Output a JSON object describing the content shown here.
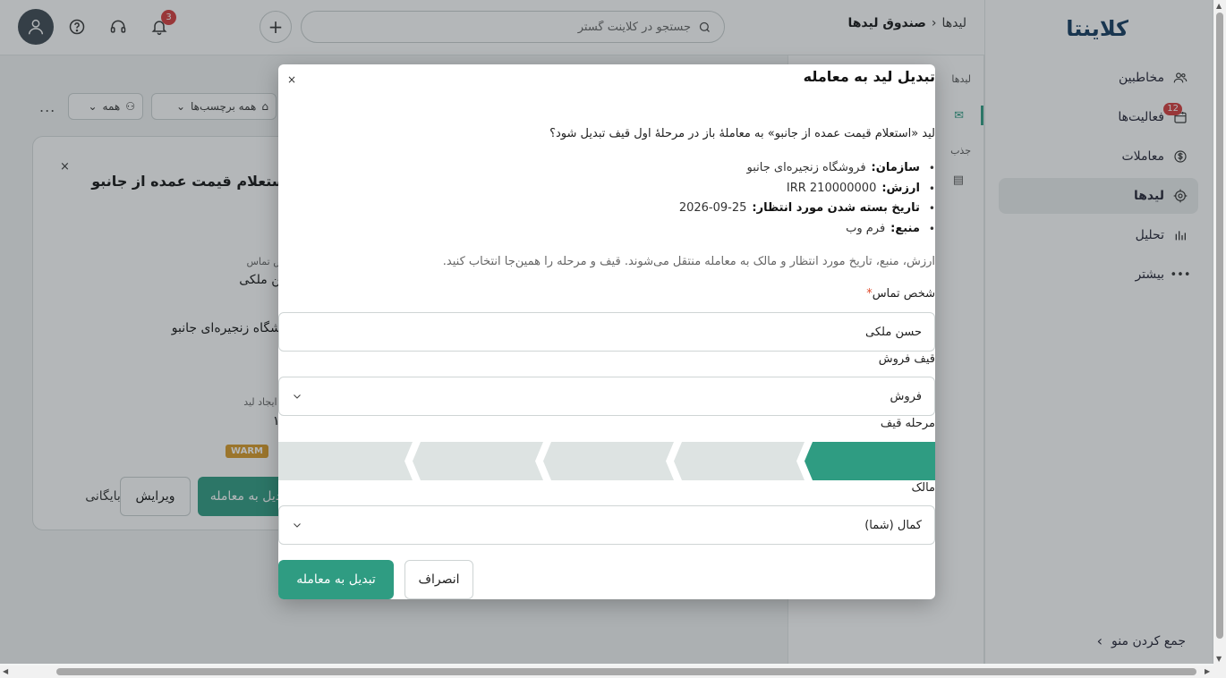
{
  "sidebar": {
    "logo": "کلاینتا",
    "items": [
      {
        "label": "مخاطبین",
        "icon": "users-icon"
      },
      {
        "label": "فعالیت‌ها",
        "icon": "calendar-icon",
        "badge": "12"
      },
      {
        "label": "معاملات",
        "icon": "dollar-icon"
      },
      {
        "label": "لیدها",
        "icon": "target-icon",
        "active": true
      },
      {
        "label": "تحلیل",
        "icon": "bar-chart-icon"
      },
      {
        "label": "بیشتر",
        "icon": "dots-icon"
      }
    ],
    "collapse_label": "جمع کردن منو"
  },
  "topbar": {
    "search_placeholder": "جستجو در کلاینت گستر",
    "notification_count": "3",
    "breadcrumb_parent": "لیدها",
    "breadcrumb_sep": "‹",
    "breadcrumb_current": "صندوق لیدها"
  },
  "filters": {
    "tags": "همه برچسب‌ها",
    "owner": "همه",
    "more": "..."
  },
  "side_panel": {
    "heading": "لیدها",
    "label2": "جذب"
  },
  "lead_card": {
    "title": "استعلام قیمت عمده از جانبو",
    "contact_label": "شخص تماس",
    "contact_value": "حسن ملکی",
    "org_value": "فروشگاه زنجیره‌ای جانبو",
    "created_label": "تاریخ ایجاد لید",
    "created_value": "۱۴۰۵",
    "temp": "WARM",
    "convert_btn": "تبدیل به معامله",
    "edit_btn": "ویرایش",
    "archive_btn": "بایگانی"
  },
  "modal": {
    "title": "تبدیل لید به معامله",
    "close": "×",
    "question": "لید «استعلام قیمت عمده از جانبو» به معاملهٔ باز در مرحلهٔ اول قیف تبدیل شود؟",
    "details": [
      {
        "label": "سازمان:",
        "value": "فروشگاه زنجیره‌ای جانبو"
      },
      {
        "label": "ارزش:",
        "value": "IRR 210000000"
      },
      {
        "label": "تاریخ بسته شدن مورد انتظار:",
        "value": "2026-09-25"
      },
      {
        "label": "منبع:",
        "value": "فرم وب"
      }
    ],
    "note": "ارزش، منبع، تاریخ مورد انتظار و مالک به معامله منتقل می‌شوند. قیف و مرحله را همین‌جا انتخاب کنید.",
    "contact_label": "شخص تماس",
    "contact_required": "*",
    "contact_value": "حسن ملکی",
    "pipeline_label": "قیف فروش",
    "pipeline_value": "فروش",
    "stage_label": "مرحله قیف",
    "stages_total": 5,
    "stage_selected": 1,
    "owner_label": "مالک",
    "owner_value": "کمال (شما)",
    "convert_btn": "تبدیل به معامله",
    "cancel_btn": "انصراف"
  },
  "colors": {
    "accent": "#2f9c82",
    "stage_inactive": "#dde3e2",
    "badge": "#d63b3b"
  }
}
